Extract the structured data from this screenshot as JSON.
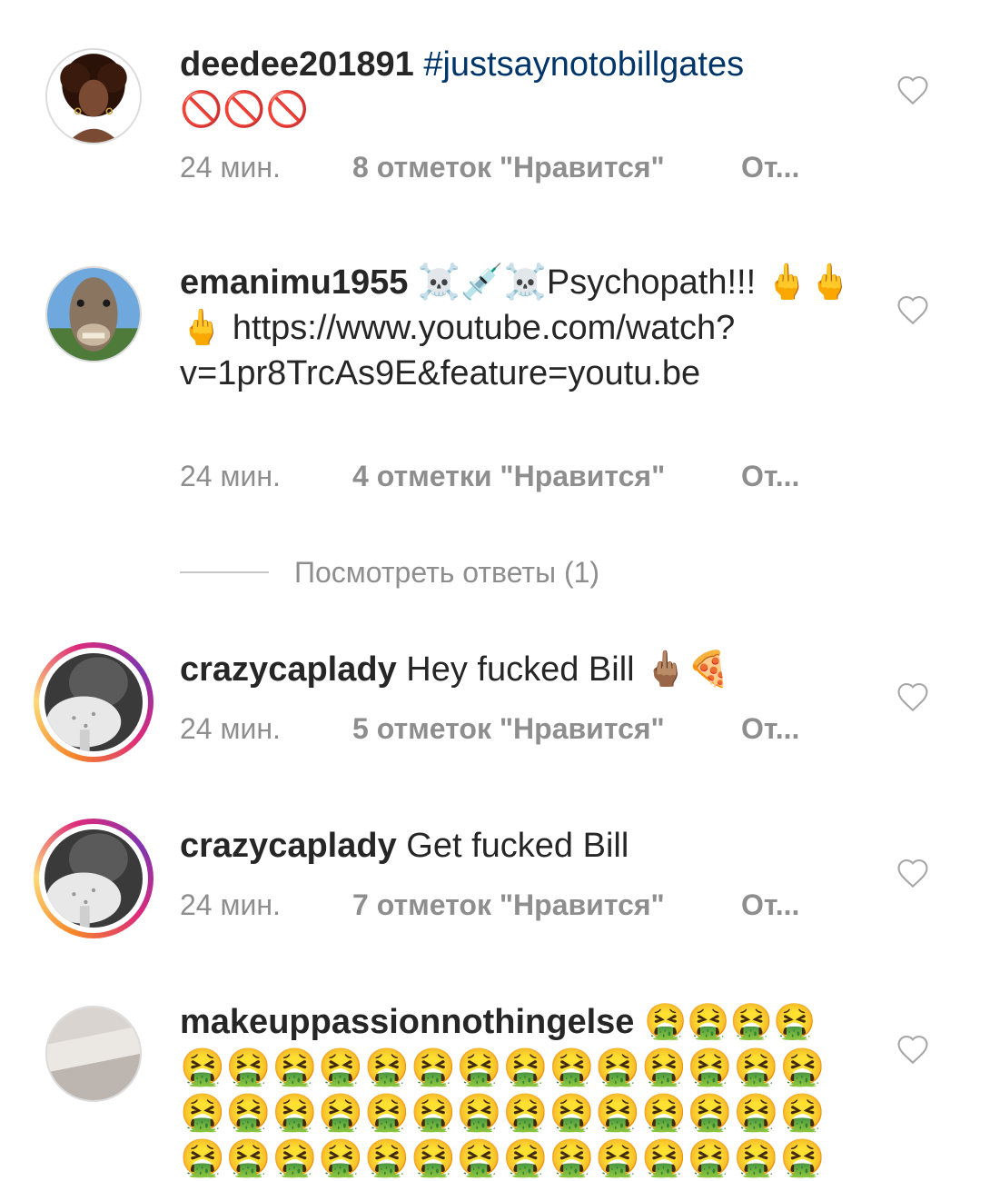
{
  "comments": [
    {
      "username": "deedee201891",
      "text": " ",
      "hashtag": "#justsaynotobillgates",
      "emoji_line": "🚫🚫🚫",
      "time": "24 мин.",
      "likes": "8 отметок \"Нравится\"",
      "reply": "От..."
    },
    {
      "username": "emanimu1955",
      "text": " ☠️💉☠️Psychopath!!! 🖕🖕🖕 https://www.youtube.com/watch?v=1pr8TrcAs9E&feature=youtu.be",
      "time": "24 мин.",
      "likes": "4 отметки \"Нравится\"",
      "reply": "От..."
    },
    {
      "username": "crazycaplady",
      "text": " Hey fucked Bill 🖕🏽🍕",
      "time": "24 мин.",
      "likes": "5 отметок \"Нравится\"",
      "reply": "От..."
    },
    {
      "username": "crazycaplady",
      "text": " Get fucked Bill",
      "time": "24 мин.",
      "likes": "7 отметок \"Нравится\"",
      "reply": "От..."
    },
    {
      "username": "makeuppassionnothingelse",
      "text": " 🤮🤮🤮🤮",
      "emoji_rows": [
        "🤮🤮🤮🤮🤮🤮🤮🤮🤮🤮🤮🤮🤮🤮",
        "🤮🤮🤮🤮🤮🤮🤮🤮🤮🤮🤮🤮🤮🤮",
        "🤮🤮🤮🤮🤮🤮🤮🤮🤮🤮🤮🤮🤮🤮"
      ]
    }
  ],
  "view_replies": "Посмотреть ответы (1)",
  "icons": {
    "heart": "heart-outline-icon"
  },
  "colors": {
    "username": "#262626",
    "hashtag": "#003569",
    "meta": "#8e8e8e"
  }
}
